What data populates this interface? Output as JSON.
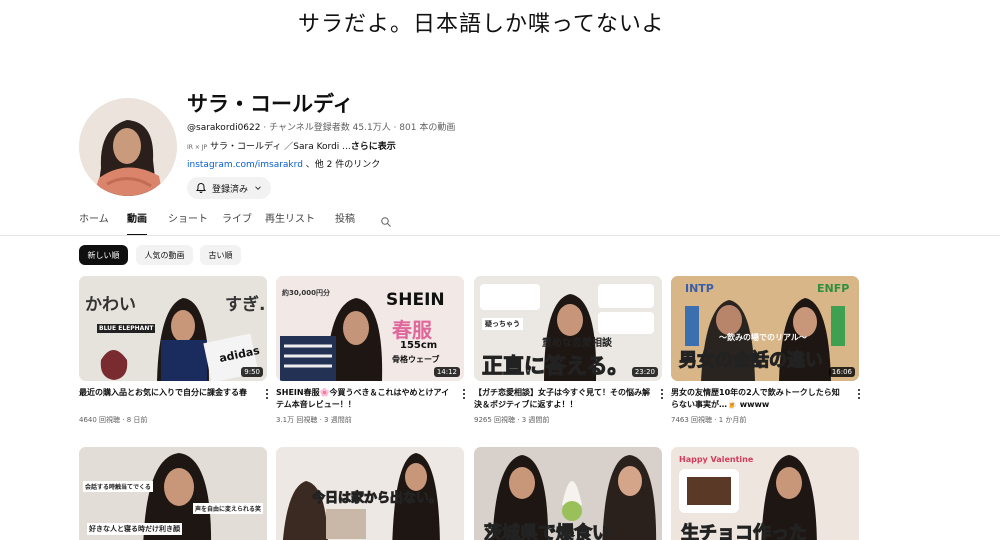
{
  "banner": {
    "text": "サラだよ。日本語しか喋ってないよ"
  },
  "channel": {
    "name": "サラ・コールディ",
    "handle": "@sarakordi0622",
    "stats": " ‧ チャンネル登録者数 45.1万人 ‧ 801 本の動画",
    "desc_flags": "IR × JP",
    "desc_text": " サラ・コールディ ／Sara Kordi ...",
    "desc_more": "さらに表示",
    "link_text": "instagram.com/imsarakrd",
    "link_other": " 、他 2 件のリンク",
    "subscribe_label": "登録済み"
  },
  "tabs": [
    {
      "label": "ホーム"
    },
    {
      "label": "動画"
    },
    {
      "label": "ショート"
    },
    {
      "label": "ライブ"
    },
    {
      "label": "再生リスト"
    },
    {
      "label": "投稿"
    }
  ],
  "chips": [
    {
      "label": "新しい順"
    },
    {
      "label": "人気の動画"
    },
    {
      "label": "古い順"
    }
  ],
  "videos": [
    {
      "title": "最近の購入品とお気に入りで自分に課金する春",
      "meta": "4640 回視聴 ‧ 8 日前",
      "duration": "9:50",
      "thumb_text": [
        "かわい",
        "すぎ..",
        "BLUE ELEPHANT",
        "adidas"
      ]
    },
    {
      "title": "SHEIN春服🌸今買うべき＆これはやめとけアイテム本音レビュー！！",
      "meta": "3.1万 回視聴 ‧ 3 週間前",
      "duration": "14:12",
      "thumb_text": [
        "SHEIN",
        "春服",
        "155cm",
        "骨格ウェーブ",
        "約30,000円分"
      ]
    },
    {
      "title": "【ガチ恋愛相談】女子は今すぐ見て！その悩み解決＆ポジティブに返すよ！！",
      "meta": "9265 回視聴 ‧ 3 週間前",
      "duration": "23:20",
      "thumb_text": [
        "重めな恋愛相談",
        "正直に答える。",
        "疑っちゃう"
      ]
    },
    {
      "title": "男女の友情歴10年の2人で飲みトークしたら知らない事実が…🍺 wwww",
      "meta": "7463 回視聴 ‧ 1 か月前",
      "duration": "16:06",
      "thumb_text": [
        "INTP",
        "ENFP",
        "〜飲みの場でのリアル〜",
        "男女の会話の違い"
      ]
    },
    {
      "thumb_text": [
        "会話する時触当てでくる",
        "声を自由に変えられる笑",
        "好きな人と寝る時だけ利き顔"
      ]
    },
    {
      "thumb_text": [
        "今日は家から出ない。"
      ]
    },
    {
      "thumb_text": [
        "茨城県で爆食い"
      ]
    },
    {
      "thumb_text": [
        "Happy Valentine",
        "生チョコ作った"
      ]
    }
  ]
}
